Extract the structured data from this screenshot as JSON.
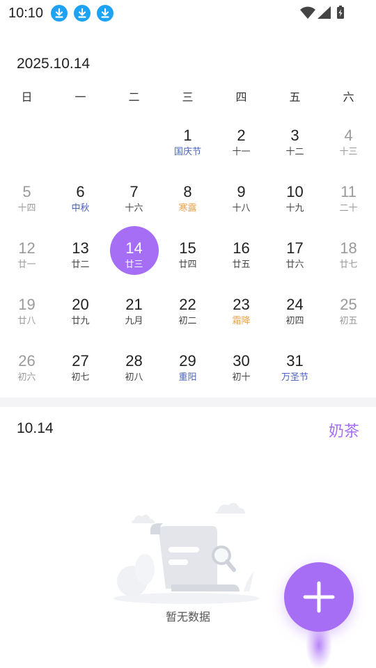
{
  "status_bar": {
    "time": "10:10",
    "download_icon_color": "#1ea2f3"
  },
  "calendar": {
    "month_title": "2025.10.14",
    "weekdays": [
      "日",
      "一",
      "二",
      "三",
      "四",
      "五",
      "六"
    ],
    "selected_color": "#a56ef5",
    "festival_color": "#4a63b8",
    "solar_term_color": "#e8a24b",
    "days": [
      {
        "num": "1",
        "sub": "国庆节"
      },
      {
        "num": "2",
        "sub": "十一"
      },
      {
        "num": "3",
        "sub": "十二"
      },
      {
        "num": "4",
        "sub": "十三"
      },
      {
        "num": "5",
        "sub": "十四"
      },
      {
        "num": "6",
        "sub": "中秋"
      },
      {
        "num": "7",
        "sub": "十六"
      },
      {
        "num": "8",
        "sub": "寒露"
      },
      {
        "num": "9",
        "sub": "十八"
      },
      {
        "num": "10",
        "sub": "十九"
      },
      {
        "num": "11",
        "sub": "二十"
      },
      {
        "num": "12",
        "sub": "廿一"
      },
      {
        "num": "13",
        "sub": "廿二"
      },
      {
        "num": "14",
        "sub": "廿三"
      },
      {
        "num": "15",
        "sub": "廿四"
      },
      {
        "num": "16",
        "sub": "廿五"
      },
      {
        "num": "17",
        "sub": "廿六"
      },
      {
        "num": "18",
        "sub": "廿七"
      },
      {
        "num": "19",
        "sub": "廿八"
      },
      {
        "num": "20",
        "sub": "廿九"
      },
      {
        "num": "21",
        "sub": "九月"
      },
      {
        "num": "22",
        "sub": "初二"
      },
      {
        "num": "23",
        "sub": "霜降"
      },
      {
        "num": "24",
        "sub": "初四"
      },
      {
        "num": "25",
        "sub": "初五"
      },
      {
        "num": "26",
        "sub": "初六"
      },
      {
        "num": "27",
        "sub": "初七"
      },
      {
        "num": "28",
        "sub": "初八"
      },
      {
        "num": "29",
        "sub": "重阳"
      },
      {
        "num": "30",
        "sub": "初十"
      },
      {
        "num": "31",
        "sub": "万圣节"
      }
    ]
  },
  "events": {
    "selected_date": "10.14",
    "category_label": "奶茶",
    "empty_text": "暂无数据"
  }
}
